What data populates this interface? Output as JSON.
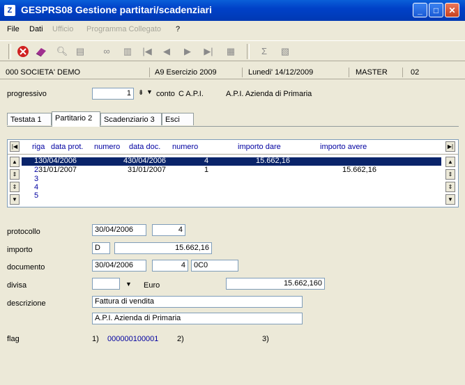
{
  "window": {
    "app_icon": "Z",
    "title": "GESPRS08  Gestione partitari/scadenziari"
  },
  "menu": [
    {
      "label": "File",
      "enabled": true
    },
    {
      "label": "Dati",
      "enabled": true
    },
    {
      "label": "Ufficio",
      "enabled": false
    },
    {
      "label": "Programma Collegato",
      "enabled": false
    },
    {
      "label": "?",
      "enabled": true
    }
  ],
  "toolbar": [
    "cancel-icon",
    "erase-icon",
    "search-icon",
    "save-icon",
    "binoculars-icon",
    "find-icon",
    "first-icon",
    "prev-icon",
    "next-icon",
    "last-icon",
    "note-icon",
    "sum-icon",
    "print-icon"
  ],
  "status": {
    "company": "000 SOCIETA' DEMO",
    "year": "A9 Esercizio 2009",
    "date": "Lunedi'  14/12/2009",
    "user": "MASTER",
    "code": "02"
  },
  "header": {
    "progressivo_label": "progressivo",
    "progressivo_value": "1",
    "conto_label": "conto",
    "conto_code": "C A.P.I.",
    "conto_desc": "A.P.I. Azienda di Primaria"
  },
  "tabs": [
    "Testata 1",
    "Partitario 2",
    "Scadenziario 3",
    "Esci"
  ],
  "grid": {
    "columns": [
      "riga",
      "data prot.",
      "numero",
      "data doc.",
      "numero",
      "importo dare",
      "importo avere"
    ],
    "rows": [
      {
        "riga": "1",
        "data_prot": "30/04/2006",
        "numero": "4",
        "data_doc": "30/04/2006",
        "numero_doc": "4",
        "dare": "15.662,16",
        "avere": ""
      },
      {
        "riga": "2",
        "data_prot": "31/01/2007",
        "numero": "",
        "data_doc": "31/01/2007",
        "numero_doc": "1",
        "dare": "",
        "avere": "15.662,16"
      },
      {
        "riga": "3",
        "data_prot": "",
        "numero": "",
        "data_doc": "",
        "numero_doc": "",
        "dare": "",
        "avere": ""
      },
      {
        "riga": "4",
        "data_prot": "",
        "numero": "",
        "data_doc": "",
        "numero_doc": "",
        "dare": "",
        "avere": ""
      },
      {
        "riga": "5",
        "data_prot": "",
        "numero": "",
        "data_doc": "",
        "numero_doc": "",
        "dare": "",
        "avere": ""
      }
    ]
  },
  "form": {
    "protocollo_label": "protocollo",
    "protocollo_date": "30/04/2006",
    "protocollo_num": "4",
    "importo_label": "importo",
    "importo_sign": "D",
    "importo_value": "15.662,16",
    "documento_label": "documento",
    "documento_date": "30/04/2006",
    "documento_num": "4",
    "documento_suffix": "0C0",
    "divisa_label": "divisa",
    "divisa_value": "",
    "divisa_name": "Euro",
    "divisa_amount": "15.662,160",
    "descrizione_label": "descrizione",
    "descrizione_1": "Fattura di vendita",
    "descrizione_2": "A.P.I. Azienda di Primaria",
    "flag_label": "flag",
    "flag1_label": "1)",
    "flag1_value": "000000100001",
    "flag2_label": "2)",
    "flag3_label": "3)"
  }
}
